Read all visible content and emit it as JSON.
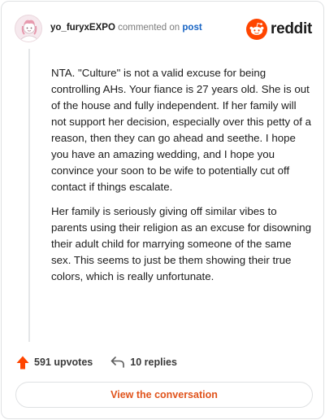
{
  "header": {
    "username": "yo_furyxEXPO",
    "verb": "commented on",
    "post_link": "post",
    "brand": "reddit",
    "avatar_icon": "snoo-avatar-icon",
    "logo_icon": "reddit-snoo-icon"
  },
  "comment": {
    "paragraphs": [
      "NTA. \"Culture\" is not a valid excuse for being controlling AHs. Your fiance is 27 years old. She is out of the house and fully independent. If her family will not support her decision, especially over this petty of a reason, then they can go ahead and seethe. I hope you have an amazing wedding, and I hope you convince your soon to be wife to potentially cut off contact if things escalate.",
      "Her family is seriously giving off similar vibes to parents using their religion as an excuse for disowning their adult child for marrying someone of the same sex. This seems to just be them showing their true colors, which is really unfortunate."
    ]
  },
  "actions": {
    "upvotes": "591 upvotes",
    "replies": "10 replies",
    "upvote_icon": "upvote-arrow-icon",
    "reply_icon": "reply-arrow-icon"
  },
  "footer": {
    "view_label": "View the conversation"
  },
  "colors": {
    "accent": "#FF4500",
    "link": "#1764C4",
    "button_text": "#E0531B"
  }
}
